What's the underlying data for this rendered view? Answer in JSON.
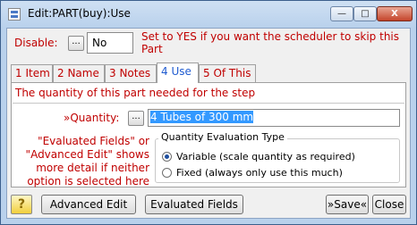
{
  "window": {
    "title": "Edit:PART(buy):Use",
    "min_symbol": "—",
    "max_symbol": "□",
    "close_symbol": "X"
  },
  "disable": {
    "label": "Disable:",
    "button_label": "...",
    "value": "No",
    "hint": "Set to YES if you want the scheduler to skip this Part"
  },
  "tabs": [
    {
      "label": "1 Item"
    },
    {
      "label": "2 Name"
    },
    {
      "label": "3 Notes"
    },
    {
      "label": "4 Use"
    },
    {
      "label": "5 Of This"
    }
  ],
  "active_tab": "4 Use",
  "use_panel": {
    "description": "The quantity of this part needed for the step",
    "quantity_label": "»Quantity:",
    "quantity_button": "...",
    "quantity_value": "4 Tubes of 300 mm",
    "side_note": "\"Evaluated Fields\" or \"Advanced Edit\" shows more detail if neither option is selected here",
    "group_title": "Quantity Evaluation Type",
    "options": [
      {
        "label": "Variable (scale quantity as required)",
        "checked": true
      },
      {
        "label": "Fixed (always only use this much)",
        "checked": false
      }
    ]
  },
  "buttons": {
    "help": "?",
    "advanced_edit": "Advanced Edit",
    "evaluated_fields": "Evaluated Fields",
    "save": "»Save«",
    "close": "Close"
  },
  "colors": {
    "label_red": "#c00000",
    "active_tab_blue": "#1f5bd0",
    "selection": "#3399ff"
  }
}
